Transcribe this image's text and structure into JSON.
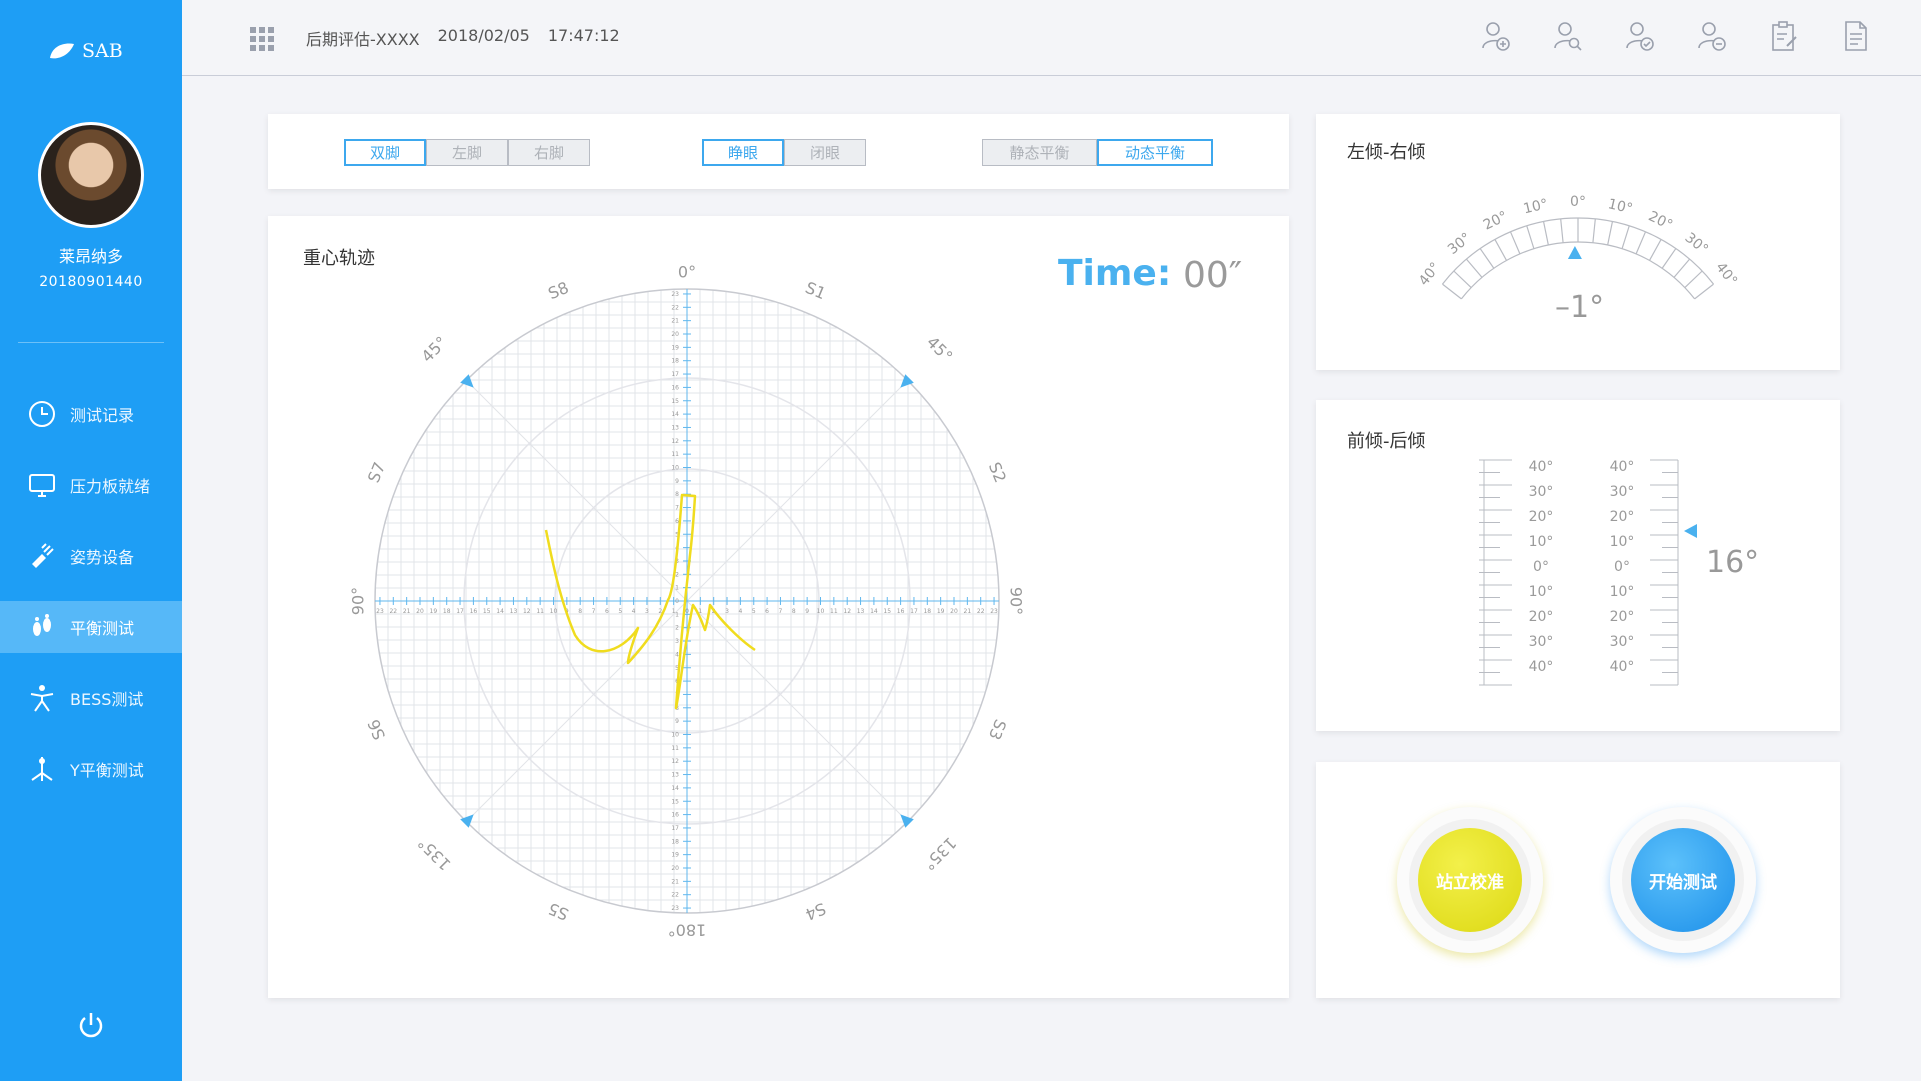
{
  "brand": {
    "name": "SAB"
  },
  "user": {
    "name": "莱昂纳多",
    "id": "20180901440"
  },
  "nav": [
    {
      "label": "测试记录",
      "icon": "clock-icon"
    },
    {
      "label": "压力板就绪",
      "icon": "monitor-icon"
    },
    {
      "label": "姿势设备",
      "icon": "device-icon"
    },
    {
      "label": "平衡测试",
      "icon": "footprint-icon",
      "active": true
    },
    {
      "label": "BESS测试",
      "icon": "person-icon"
    },
    {
      "label": "Y平衡测试",
      "icon": "y-balance-icon"
    }
  ],
  "header": {
    "title": "后期评估-XXXX",
    "date": "2018/02/05",
    "time": "17:47:12"
  },
  "header_icons": [
    "add-user-icon",
    "search-user-icon",
    "verify-user-icon",
    "remove-user-icon",
    "clipboard-edit-icon",
    "document-icon"
  ],
  "controls": {
    "feet": [
      "双脚",
      "左脚",
      "右脚"
    ],
    "eyes": [
      "睁眼",
      "闭眼"
    ],
    "balance": [
      "静态平衡",
      "动态平衡"
    ],
    "selected": {
      "feet": "双脚",
      "eyes": "睁眼",
      "balance": "动态平衡"
    }
  },
  "trajectory": {
    "title": "重心轨迹",
    "time_label": "Time:",
    "time_value": "00″",
    "compass": {
      "top": "0°",
      "bottom": "180°",
      "left": "90°",
      "right": "90°",
      "diag": "45°",
      "diag_low": "135°",
      "sectors": [
        "S1",
        "S2",
        "S3",
        "S4",
        "S5",
        "S6",
        "S7",
        "S8"
      ]
    },
    "axis_ticks": [
      "23",
      "22",
      "21",
      "20",
      "19",
      "18",
      "17",
      "16",
      "15",
      "14",
      "13",
      "12",
      "11",
      "10",
      "9",
      "8",
      "7",
      "6",
      "5",
      "4",
      "3",
      "2",
      "1",
      "0",
      "1",
      "2",
      "3",
      "4",
      "5",
      "6",
      "7",
      "8",
      "9",
      "10",
      "11",
      "12",
      "13",
      "14",
      "15",
      "16",
      "17",
      "18",
      "19",
      "20",
      "21",
      "22",
      "23"
    ]
  },
  "tilt_lr": {
    "title": "左倾-右倾",
    "ticks": [
      "40°",
      "30°",
      "20°",
      "10°",
      "0°",
      "10°",
      "20°",
      "30°",
      "40°"
    ],
    "value": "–1°"
  },
  "tilt_fb": {
    "title": "前倾-后倾",
    "ticks": [
      "40°",
      "30°",
      "20°",
      "10°",
      "0°",
      "10°",
      "20°",
      "30°",
      "40°"
    ],
    "value": "16°"
  },
  "actions": {
    "calibrate": "站立校准",
    "start": "开始测试"
  },
  "colors": {
    "primary": "#1e9ef5",
    "accent": "#3da8ee",
    "trace": "#f0dc1e",
    "calibrate": "#e6e31f",
    "start": "#2da0f4"
  }
}
